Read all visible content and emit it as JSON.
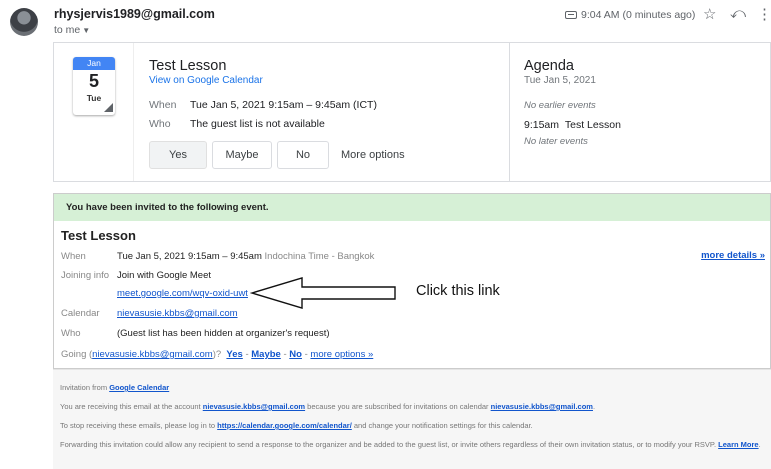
{
  "header": {
    "sender": "rhysjervis1989@gmail.com",
    "to": "to me",
    "time": "9:04 AM (0 minutes ago)",
    "icons": [
      "label-icon",
      "star-icon",
      "reply-icon",
      "more-vert-icon"
    ]
  },
  "calendar_card": {
    "icon": {
      "month": "Jan",
      "day": "5",
      "weekday": "Tue"
    },
    "title": "Test Lesson",
    "view_link": "View on Google Calendar",
    "when_label": "When",
    "when_value": "Tue Jan 5, 2021 9:15am – 9:45am (ICT)",
    "who_label": "Who",
    "who_value": "The guest list is not available",
    "buttons": {
      "yes": "Yes",
      "maybe": "Maybe",
      "no": "No"
    },
    "more_options": "More options",
    "agenda": {
      "title": "Agenda",
      "date": "Tue Jan 5, 2021",
      "no_earlier": "No earlier events",
      "event_time": "9:15am",
      "event_name": "Test Lesson",
      "no_later": "No later events"
    }
  },
  "invitation": {
    "banner": "You have been invited to the following event.",
    "title": "Test Lesson",
    "more_details": "more details »",
    "when_label": "When",
    "when_value": "Tue Jan 5, 2021 9:15am – 9:45am",
    "when_tz": "Indochina Time - Bangkok",
    "joining_label": "Joining info",
    "joining_value": "Join with Google Meet",
    "meet_link": "meet.google.com/wqv-oxid-uwt",
    "calendar_label": "Calendar",
    "calendar_value": "nievasusie.kbbs@gmail.com",
    "who_label": "Who",
    "who_value": "(Guest list has been hidden at organizer's request)",
    "going_prefix": "Going (",
    "going_email": "nievasusie.kbbs@gmail.com",
    "going_suffix": ")?",
    "going_yes": "Yes",
    "going_maybe": "Maybe",
    "going_no": "No",
    "going_more": "more options »",
    "sep": "-"
  },
  "annotation": {
    "text": "Click this link"
  },
  "footer": {
    "line1_prefix": "Invitation from ",
    "line1_link": "Google Calendar",
    "line2_a": "You are receiving this email at the account ",
    "line2_link1": "nievasusie.kbbs@gmail.com",
    "line2_b": " because you are subscribed for invitations on calendar ",
    "line2_link2": "nievasusie.kbbs@gmail.com",
    "line2_c": ".",
    "line3_a": "To stop receiving these emails, please log in to ",
    "line3_link": "https://calendar.google.com/calendar/",
    "line3_b": " and change your notification settings for this calendar.",
    "line4_a": "Forwarding this invitation could allow any recipient to send a response to the organizer and be added to the guest list, or invite others regardless of their own invitation status, or to modify your RSVP. ",
    "line4_link": "Learn More",
    "line4_b": "."
  },
  "colors": {
    "banner_bg": "#d6f0d6",
    "link": "#1155cc",
    "calendar_blue": "#4285f4"
  }
}
